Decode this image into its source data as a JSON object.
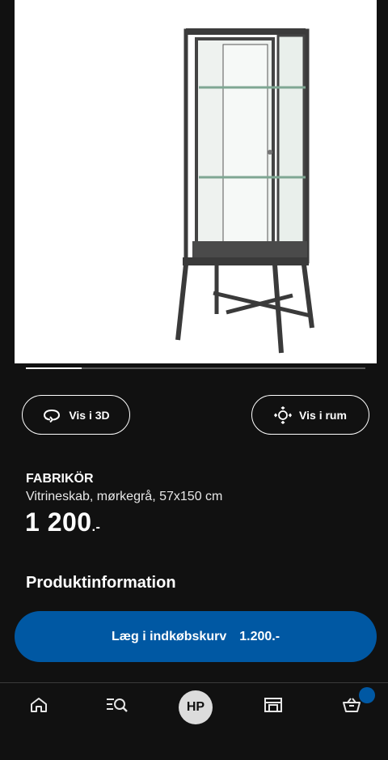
{
  "product_image": {
    "alt": "FABRIKÖR glass-door cabinet, dark grey"
  },
  "carousel": {
    "progress": 0.165
  },
  "actions": {
    "view_3d_label": "Vis i 3D",
    "view_room_label": "Vis i rum"
  },
  "product": {
    "name": "FABRIKÖR",
    "description": "Vitrineskab, mørkegrå, 57x150 cm",
    "price_main": "1 200",
    "price_suffix": ".-"
  },
  "section": {
    "title": "Produktinformation"
  },
  "cart_button": {
    "label": "Læg i indkøbskurv",
    "price": "1.200.-"
  },
  "nav": {
    "home_icon": "home-icon",
    "search_icon": "search-icon",
    "profile_initials": "HP",
    "store_icon": "store-icon",
    "cart_icon": "cart-icon"
  },
  "colors": {
    "background": "#111111",
    "accent": "#0058a3",
    "text": "#ffffff"
  }
}
